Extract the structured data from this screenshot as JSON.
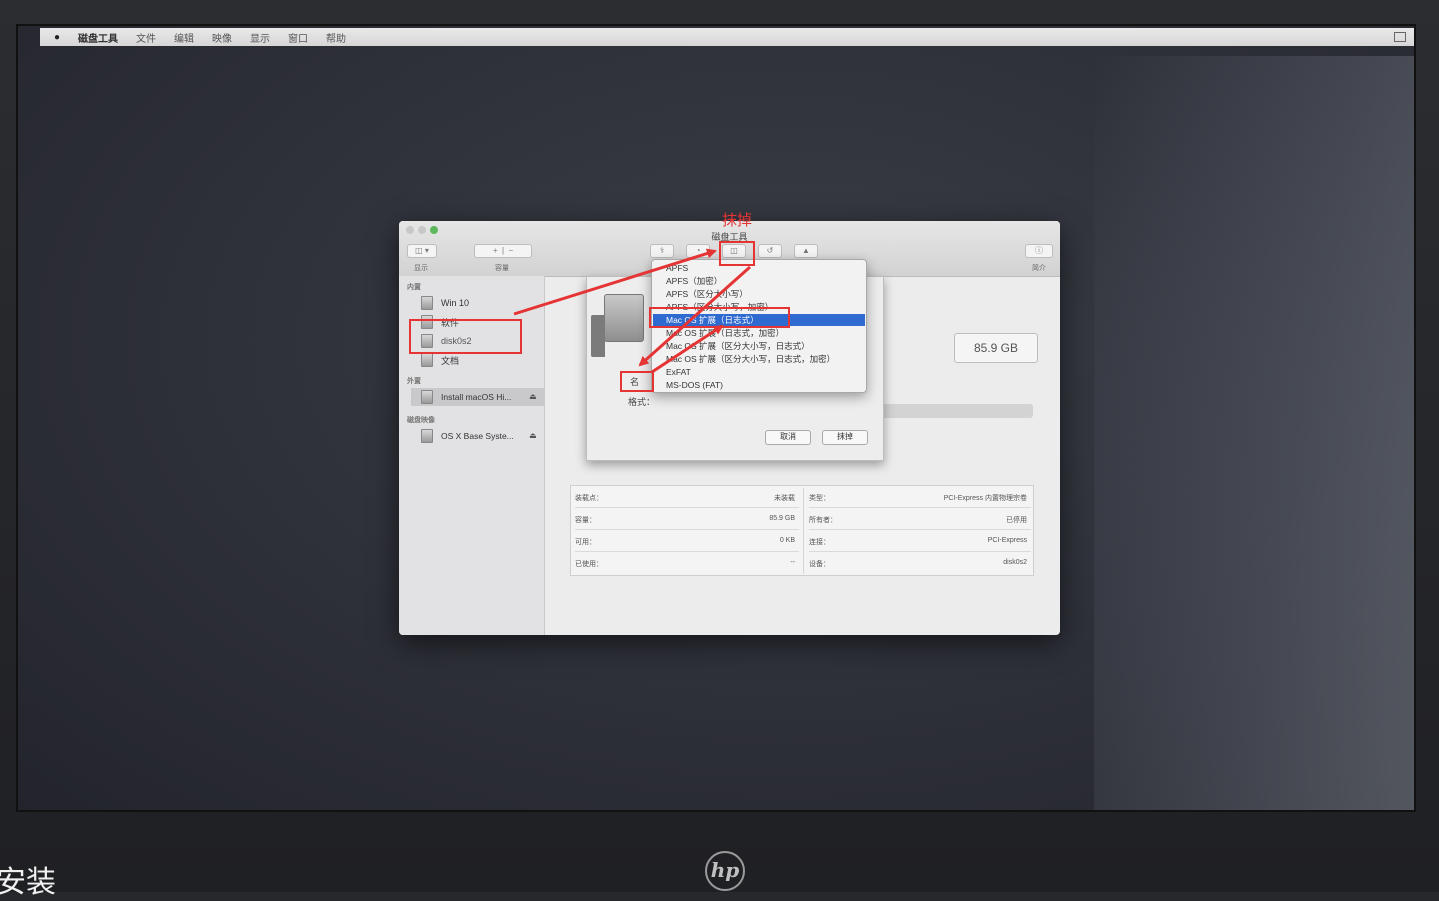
{
  "menubar": {
    "app_name": "磁盘工具",
    "items": [
      "文件",
      "编辑",
      "映像",
      "显示",
      "窗口",
      "帮助"
    ]
  },
  "window": {
    "title": "磁盘工具",
    "toolbar_left_labels": [
      "显示",
      "容量"
    ],
    "toolbar_right_label": "简介"
  },
  "sidebar": {
    "internal_header": "内置",
    "items": [
      "Win 10",
      "软件",
      "disk0s2",
      "文档"
    ],
    "external_header": "外置",
    "external_items": [
      "Install macOS Hi..."
    ],
    "images_header": "磁盘映像",
    "image_items": [
      "OS X Base Syste..."
    ]
  },
  "main": {
    "size": "85.9 GB",
    "info_left": [
      {
        "label": "装载点：",
        "value": "未装载"
      },
      {
        "label": "容量：",
        "value": "85.9 GB"
      },
      {
        "label": "可用：",
        "value": "0 KB"
      },
      {
        "label": "已使用：",
        "value": "--"
      }
    ],
    "info_right": [
      {
        "label": "类型：",
        "value": "PCI-Express 内置物理宗卷"
      },
      {
        "label": "所有者：",
        "value": "已停用"
      },
      {
        "label": "连接：",
        "value": "PCI-Express"
      },
      {
        "label": "设备：",
        "value": "disk0s2"
      }
    ]
  },
  "sheet": {
    "name_prefix": "名",
    "format_label": "格式：",
    "cancel_label": "取消",
    "erase_label": "抹掉"
  },
  "format_menu": {
    "options": [
      "APFS",
      "APFS（加密）",
      "APFS（区分大小写）",
      "APFS（区分大小写，加密）",
      "Mac OS 扩展（日志式）",
      "Mac OS 扩展（日志式，加密）",
      "Mac OS 扩展（区分大小写，日志式）",
      "Mac OS 扩展（区分大小写，日志式，加密）",
      "ExFAT",
      "MS-DOS (FAT)"
    ],
    "selected": "Mac OS 扩展（日志式）"
  },
  "annotation": {
    "erase_label": "抹掉"
  },
  "bottom": {
    "caption": "安装",
    "logo": "hp"
  },
  "colors": {
    "annotation_red": "#e53434",
    "menu_selection": "#2f6ad1"
  }
}
